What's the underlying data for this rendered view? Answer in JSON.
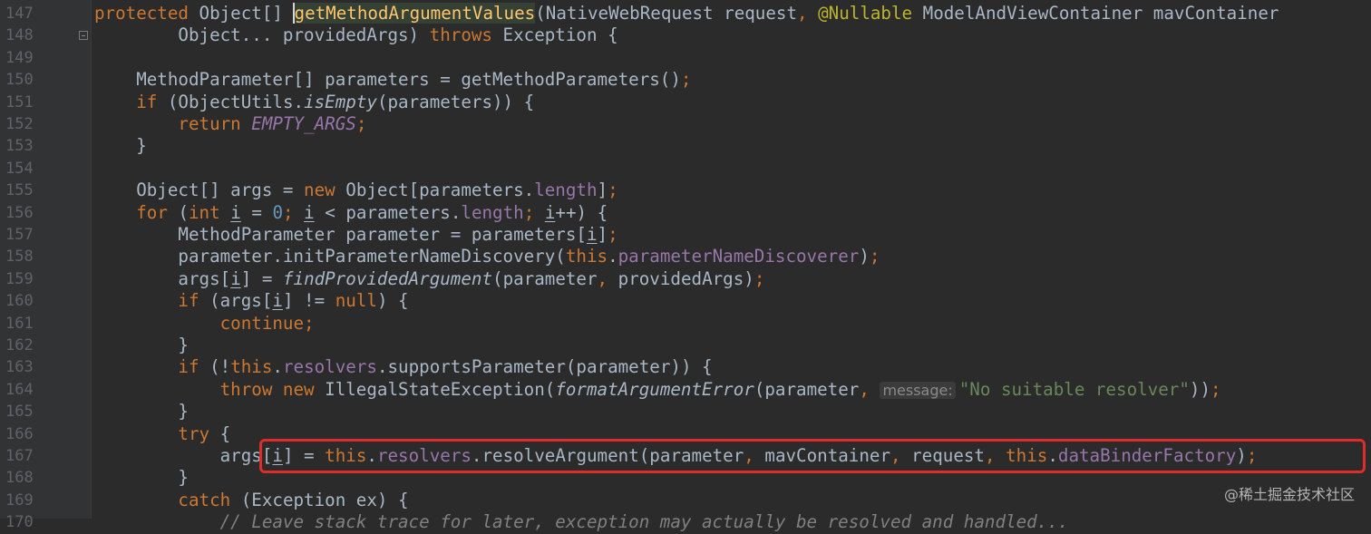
{
  "gutter": {
    "line_numbers": [
      "147",
      "148",
      "149",
      "150",
      "151",
      "152",
      "153",
      "154",
      "155",
      "156",
      "157",
      "158",
      "159",
      "160",
      "161",
      "162",
      "163",
      "164",
      "165",
      "166",
      "167",
      "168",
      "169",
      "170"
    ]
  },
  "code": {
    "lines": [
      [
        {
          "t": "protected ",
          "c": "kw"
        },
        {
          "t": "Object[] "
        },
        {
          "t": "g",
          "c": "method caret sel"
        },
        {
          "t": "etMethodArgumentValues",
          "c": "method sel"
        },
        {
          "t": "(NativeWebRequest request"
        },
        {
          "t": ", ",
          "c": "kw"
        },
        {
          "t": "@Nullable ",
          "c": "ann"
        },
        {
          "t": "ModelAndViewContainer mavContainer"
        }
      ],
      [
        {
          "t": "        Object... providedArgs) "
        },
        {
          "t": "throws ",
          "c": "kw"
        },
        {
          "t": "Exception {"
        }
      ],
      [],
      [
        {
          "t": "    MethodParameter[] parameters = getMethodParameters()"
        },
        {
          "t": ";",
          "c": "kw"
        }
      ],
      [
        {
          "t": "    "
        },
        {
          "t": "if ",
          "c": "kw"
        },
        {
          "t": "(ObjectUtils."
        },
        {
          "t": "isEmpty",
          "c": "italic"
        },
        {
          "t": "(parameters)) {"
        }
      ],
      [
        {
          "t": "        "
        },
        {
          "t": "return ",
          "c": "kw"
        },
        {
          "t": "EMPTY_ARGS",
          "c": "static"
        },
        {
          "t": ";",
          "c": "kw"
        }
      ],
      [
        {
          "t": "    }"
        }
      ],
      [],
      [
        {
          "t": "    Object[] args = "
        },
        {
          "t": "new ",
          "c": "kw"
        },
        {
          "t": "Object[parameters."
        },
        {
          "t": "length",
          "c": "field"
        },
        {
          "t": "]"
        },
        {
          "t": ";",
          "c": "kw"
        }
      ],
      [
        {
          "t": "    "
        },
        {
          "t": "for ",
          "c": "kw"
        },
        {
          "t": "("
        },
        {
          "t": "int ",
          "c": "kw"
        },
        {
          "t": "i",
          "c": "u"
        },
        {
          "t": " = "
        },
        {
          "t": "0",
          "c": "num"
        },
        {
          "t": "; ",
          "c": "kw"
        },
        {
          "t": "i",
          "c": "u"
        },
        {
          "t": " < parameters."
        },
        {
          "t": "length",
          "c": "field"
        },
        {
          "t": "; ",
          "c": "kw"
        },
        {
          "t": "i",
          "c": "u"
        },
        {
          "t": "++) {"
        }
      ],
      [
        {
          "t": "        MethodParameter parameter = parameters["
        },
        {
          "t": "i",
          "c": "u"
        },
        {
          "t": "]"
        },
        {
          "t": ";",
          "c": "kw"
        }
      ],
      [
        {
          "t": "        parameter.initParameterNameDiscovery("
        },
        {
          "t": "this",
          "c": "kw"
        },
        {
          "t": "."
        },
        {
          "t": "parameterNameDiscoverer",
          "c": "field"
        },
        {
          "t": ")"
        },
        {
          "t": ";",
          "c": "kw"
        }
      ],
      [
        {
          "t": "        args["
        },
        {
          "t": "i",
          "c": "u"
        },
        {
          "t": "] = "
        },
        {
          "t": "findProvidedArgument",
          "c": "italic"
        },
        {
          "t": "(parameter"
        },
        {
          "t": ", ",
          "c": "kw"
        },
        {
          "t": "providedArgs)"
        },
        {
          "t": ";",
          "c": "kw"
        }
      ],
      [
        {
          "t": "        "
        },
        {
          "t": "if ",
          "c": "kw"
        },
        {
          "t": "(args["
        },
        {
          "t": "i",
          "c": "u"
        },
        {
          "t": "] != "
        },
        {
          "t": "null",
          "c": "kw"
        },
        {
          "t": ") {"
        }
      ],
      [
        {
          "t": "            "
        },
        {
          "t": "continue;",
          "c": "kw"
        }
      ],
      [
        {
          "t": "        }"
        }
      ],
      [
        {
          "t": "        "
        },
        {
          "t": "if ",
          "c": "kw"
        },
        {
          "t": "(!"
        },
        {
          "t": "this",
          "c": "kw"
        },
        {
          "t": "."
        },
        {
          "t": "resolvers",
          "c": "field"
        },
        {
          "t": ".supportsParameter(parameter)) {"
        }
      ],
      [
        {
          "t": "            "
        },
        {
          "t": "throw new ",
          "c": "kw"
        },
        {
          "t": "IllegalStateException("
        },
        {
          "t": "formatArgumentError",
          "c": "italic"
        },
        {
          "t": "(parameter"
        },
        {
          "t": ", ",
          "c": "kw"
        },
        {
          "t": "message:",
          "c": "hint"
        },
        {
          "t": "\"No suitable resolver\"",
          "c": "str"
        },
        {
          "t": "))"
        },
        {
          "t": ";",
          "c": "kw"
        }
      ],
      [
        {
          "t": "        }"
        }
      ],
      [
        {
          "t": "        "
        },
        {
          "t": "try ",
          "c": "kw"
        },
        {
          "t": "{"
        }
      ],
      [
        {
          "t": "            args["
        },
        {
          "t": "i",
          "c": "u"
        },
        {
          "t": "] = "
        },
        {
          "t": "this",
          "c": "kw"
        },
        {
          "t": "."
        },
        {
          "t": "resolvers",
          "c": "field"
        },
        {
          "t": ".resolveArgument(parameter"
        },
        {
          "t": ", ",
          "c": "kw"
        },
        {
          "t": "mavContainer"
        },
        {
          "t": ", ",
          "c": "kw"
        },
        {
          "t": "request"
        },
        {
          "t": ", ",
          "c": "kw"
        },
        {
          "t": "this",
          "c": "kw"
        },
        {
          "t": "."
        },
        {
          "t": "dataBinderFactory",
          "c": "field"
        },
        {
          "t": ")"
        },
        {
          "t": ";",
          "c": "kw"
        }
      ],
      [
        {
          "t": "        }"
        }
      ],
      [
        {
          "t": "        "
        },
        {
          "t": "catch ",
          "c": "kw"
        },
        {
          "t": "(Exception ex) {"
        }
      ],
      [
        {
          "t": "            "
        },
        {
          "t": "// Leave stack trace for later, exception may actually be resolved and handled...",
          "c": "comment"
        }
      ]
    ]
  },
  "watermark": "@稀土掘金技术社区"
}
